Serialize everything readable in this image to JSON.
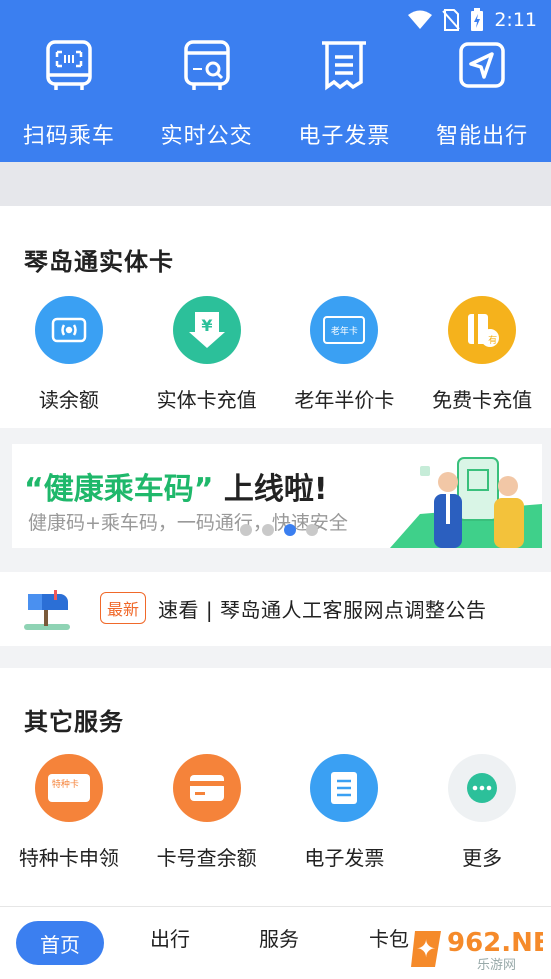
{
  "status": {
    "time": "2:11"
  },
  "quick_actions": [
    {
      "label": "扫码乘车",
      "icon": "bus-qr-icon"
    },
    {
      "label": "实时公交",
      "icon": "bus-search-icon"
    },
    {
      "label": "电子发票",
      "icon": "receipt-icon"
    },
    {
      "label": "智能出行",
      "icon": "navigation-icon"
    }
  ],
  "physical_card": {
    "title": "琴岛通实体卡",
    "items": [
      {
        "label": "读余额",
        "icon": "nfc-read-icon",
        "color": "#3aa0f3"
      },
      {
        "label": "实体卡充值",
        "icon": "yen-download-icon",
        "color": "#2cc09a"
      },
      {
        "label": "老年半价卡",
        "icon": "senior-card-icon",
        "color": "#3aa0f3",
        "badge": "老年卡"
      },
      {
        "label": "免费卡充值",
        "icon": "free-card-icon",
        "color": "#f5b21c",
        "badge": "有"
      }
    ]
  },
  "promo": {
    "title_quoted": "“健康乘车码”",
    "title_rest": " 上线啦!",
    "subtitle": "健康码+乘车码，一码通行，快速安全",
    "active_index": 2,
    "count": 4
  },
  "notice": {
    "tag": "最新",
    "text": "速看 | 琴岛通人工客服网点调整公告"
  },
  "other_services": {
    "title": "其它服务",
    "items": [
      {
        "label": "特种卡申领",
        "icon": "special-card-icon",
        "color": "#f5833a",
        "badge": "特种卡"
      },
      {
        "label": "卡号查余额",
        "icon": "card-balance-icon",
        "color": "#f5833a"
      },
      {
        "label": "电子发票",
        "icon": "invoice-icon",
        "color": "#3aa0f3"
      },
      {
        "label": "更多",
        "icon": "more-icon",
        "color": "#eef1f3"
      }
    ]
  },
  "tabbar": {
    "items": [
      "首页",
      "出行",
      "服务",
      "卡包"
    ],
    "active": "首页"
  },
  "watermark": {
    "text": "962.NET",
    "sub": "乐游网"
  }
}
